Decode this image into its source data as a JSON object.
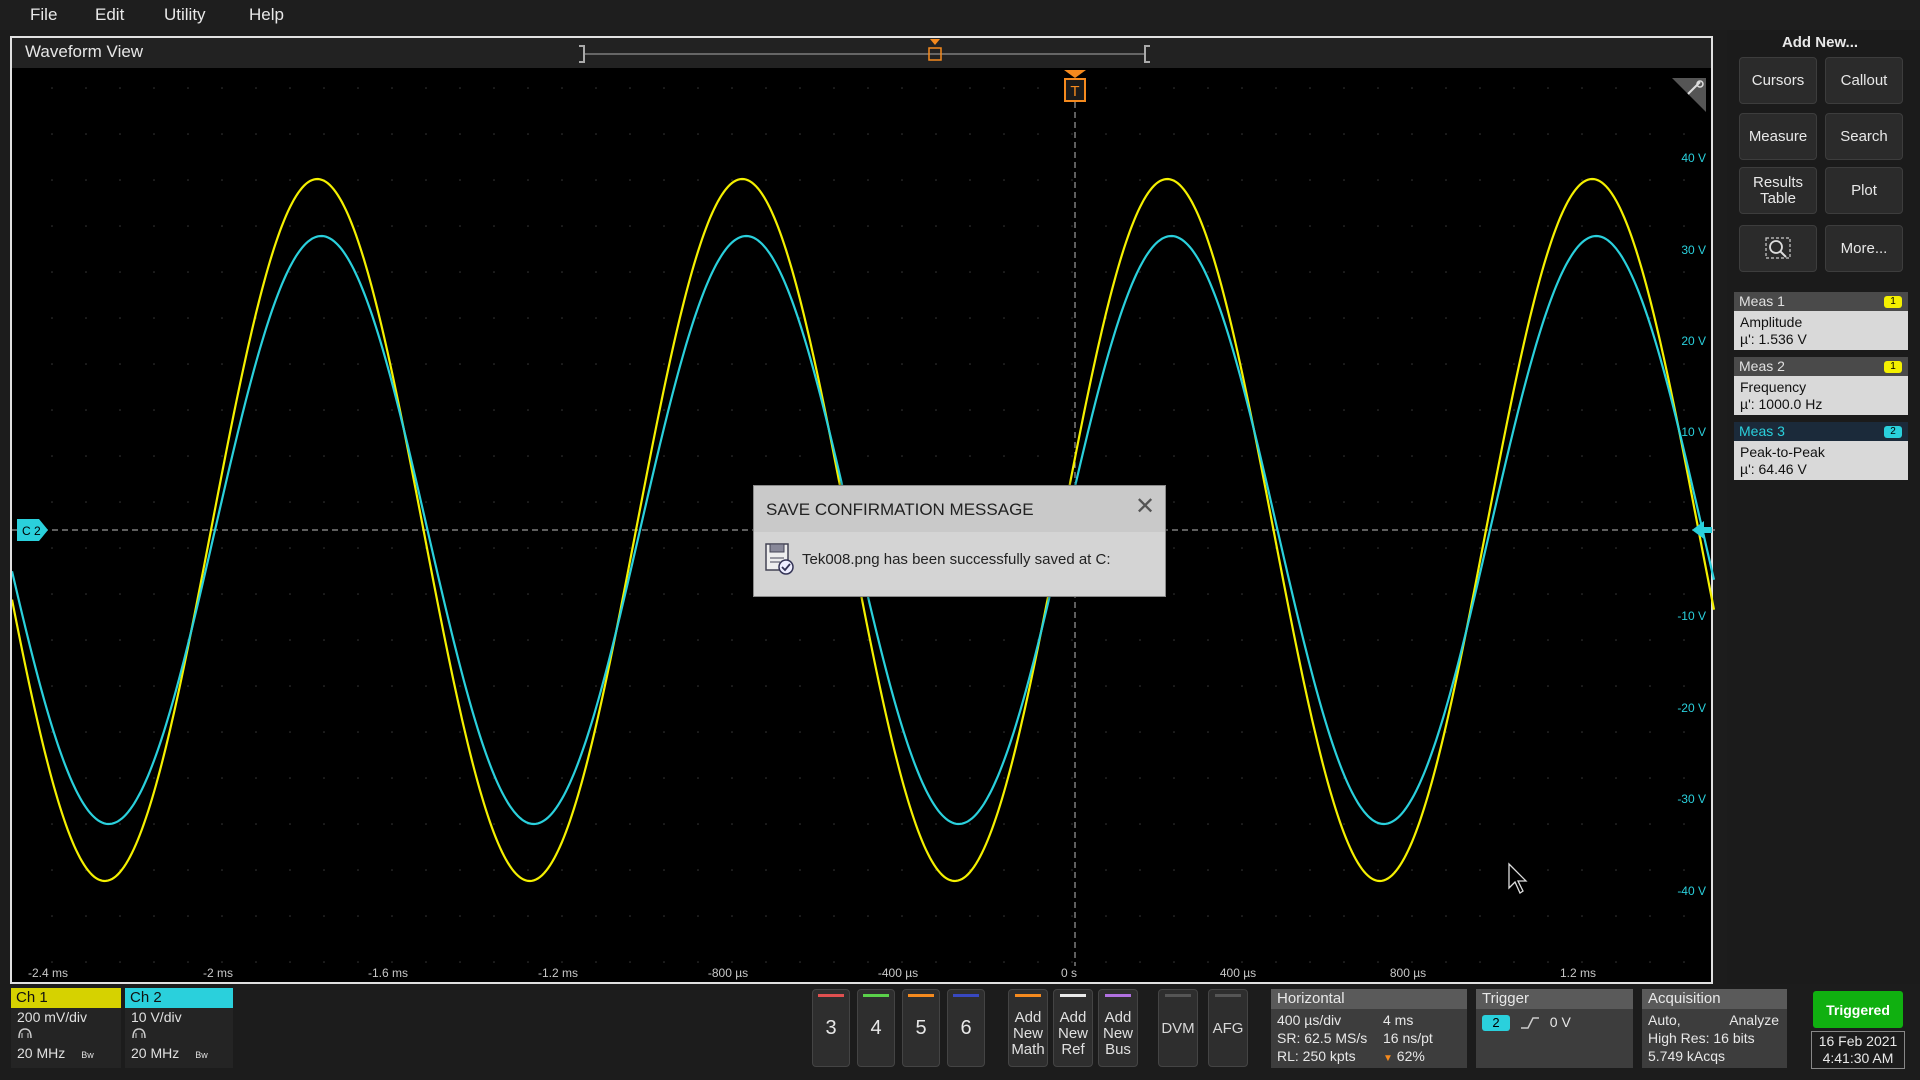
{
  "menu": {
    "file": "File",
    "edit": "Edit",
    "utility": "Utility",
    "help": "Help"
  },
  "waveform_view": {
    "title": "Waveform View",
    "channel_marker": "C 2",
    "trigger_marker": "T",
    "right_axis_labels": [
      "40 V",
      "30 V",
      "20 V",
      "10 V",
      "-10 V",
      "-20 V",
      "-30 V",
      "-40 V"
    ],
    "time_labels": [
      "-2.4 ms",
      "-2 ms",
      "-1.6 ms",
      "-1.2 ms",
      "-800 µs",
      "-400 µs",
      "0 s",
      "400 µs",
      "800 µs",
      "1.2 ms"
    ]
  },
  "colors": {
    "ch1": "#f4f000",
    "ch2": "#2ad0dc",
    "trigger": "#f58a1e",
    "triggered": "#10b010"
  },
  "dialog": {
    "title": "SAVE CONFIRMATION MESSAGE",
    "message": "Tek008.png has been successfully saved at C:",
    "close_icon": "close-icon",
    "icon": "saved-file-icon"
  },
  "right_panel": {
    "add_new_title": "Add New...",
    "buttons": {
      "cursors": "Cursors",
      "callout": "Callout",
      "measure": "Measure",
      "search": "Search",
      "results_table_1": "Results",
      "results_table_2": "Table",
      "plot": "Plot",
      "zoom_icon": "zoom-icon",
      "more": "More..."
    },
    "measurements": [
      {
        "head": "Meas 1",
        "badge": "1",
        "name": "Amplitude",
        "value": "µ': 1.536 V"
      },
      {
        "head": "Meas 2",
        "badge": "1",
        "name": "Frequency",
        "value": "µ': 1000.0 Hz"
      },
      {
        "head": "Meas 3",
        "badge": "2",
        "name": "Peak-to-Peak",
        "value": "µ': 64.46 V"
      }
    ]
  },
  "channels": [
    {
      "label": "Ch 1",
      "scale": "200 mV/div",
      "bandwidth": "20 MHz",
      "bw_tag": "Bw"
    },
    {
      "label": "Ch 2",
      "scale": "10 V/div",
      "bandwidth": "20 MHz",
      "bw_tag": "Bw"
    }
  ],
  "channel_buttons": [
    "3",
    "4",
    "5",
    "6"
  ],
  "add_buttons": [
    {
      "l1": "Add",
      "l2": "New",
      "l3": "Math"
    },
    {
      "l1": "Add",
      "l2": "New",
      "l3": "Ref"
    },
    {
      "l1": "Add",
      "l2": "New",
      "l3": "Bus"
    }
  ],
  "dvm": "DVM",
  "afg": "AFG",
  "horizontal": {
    "title": "Horizontal",
    "scale": "400 µs/div",
    "record": "4 ms",
    "sr": "SR: 62.5 MS/s",
    "pt": "16 ns/pt",
    "rl": "RL: 250 kpts",
    "pos": "62%"
  },
  "trigger": {
    "title": "Trigger",
    "source": "2",
    "level": "0 V"
  },
  "acquisition": {
    "title": "Acquisition",
    "mode": "Auto,",
    "analyze": "Analyze",
    "resolution": "High Res: 16 bits",
    "acqs": "5.749 kAcqs"
  },
  "status": {
    "triggered": "Triggered",
    "date": "16 Feb 2021",
    "time": "4:41:30 AM"
  }
}
